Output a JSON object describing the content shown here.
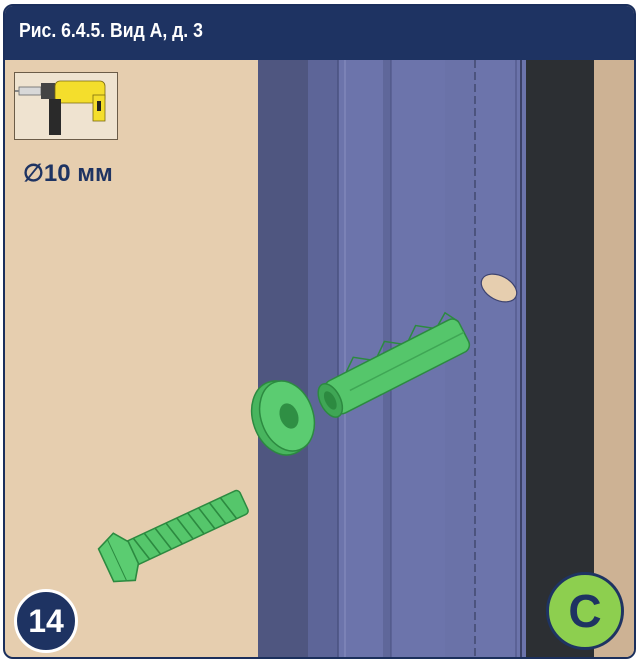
{
  "header": {
    "title": "Рис. 6.4.5. Вид А, д. 3"
  },
  "tool": {
    "icon": "drill-icon",
    "drill_size": "∅10 мм"
  },
  "badges": {
    "step_number": "14",
    "variant_letter": "C"
  },
  "colors": {
    "header_bg": "#1e3362",
    "wall": "#e6ceaf",
    "profile": "#6e76b0",
    "fastener": "#55c66b",
    "badge_green": "#8dcf4f"
  }
}
